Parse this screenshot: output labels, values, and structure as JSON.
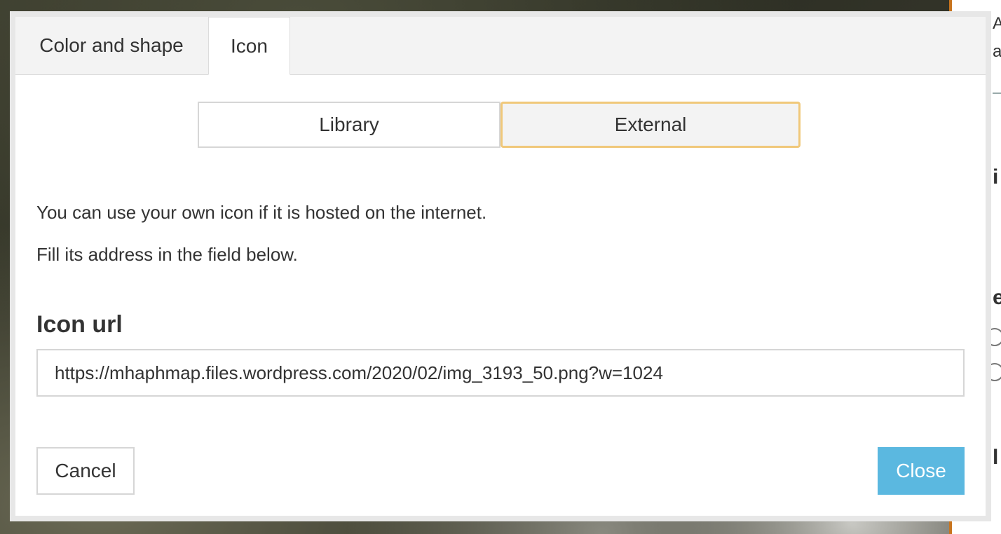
{
  "tabs": [
    {
      "label": "Color and shape"
    },
    {
      "label": "Icon"
    }
  ],
  "icon_source": {
    "options": [
      "Library",
      "External"
    ],
    "selected": "External"
  },
  "content": {
    "line1": "You can use your own icon if it is hosted on the internet.",
    "line2": "Fill its address in the field below."
  },
  "icon_url": {
    "label": "Icon url",
    "value": "https://mhaphmap.files.wordpress.com/2020/02/img_3193_50.png?w=1024"
  },
  "buttons": {
    "cancel": "Cancel",
    "close": "Close"
  },
  "colors": {
    "selected_border": "#f0c87a",
    "close_button": "#5bb8e0",
    "side_panel_accent": "#c8741e"
  }
}
